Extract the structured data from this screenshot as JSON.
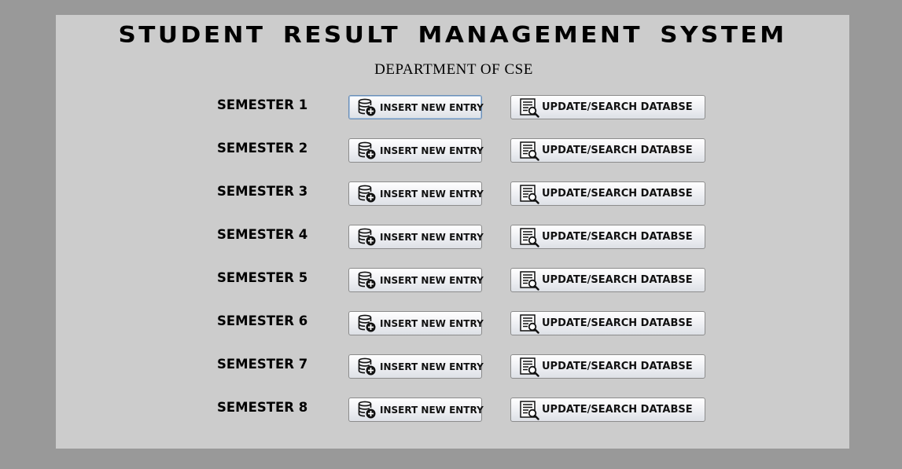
{
  "app": {
    "title": "STUDENT RESULT MANAGEMENT SYSTEM",
    "subtitle": "DEPARTMENT OF CSE"
  },
  "icons": {
    "insert": "database-add-icon",
    "update": "database-search-icon"
  },
  "semesters": [
    {
      "label": "SEMESTER 1",
      "insert_label": "INSERT NEW ENTRY",
      "update_label": "UPDATE/SEARCH DATABSE"
    },
    {
      "label": "SEMESTER 2",
      "insert_label": "INSERT NEW ENTRY",
      "update_label": "UPDATE/SEARCH DATABSE"
    },
    {
      "label": "SEMESTER 3",
      "insert_label": "INSERT NEW ENTRY",
      "update_label": "UPDATE/SEARCH DATABSE"
    },
    {
      "label": "SEMESTER 4",
      "insert_label": "INSERT NEW ENTRY",
      "update_label": "UPDATE/SEARCH DATABSE"
    },
    {
      "label": "SEMESTER 5",
      "insert_label": "INSERT NEW ENTRY",
      "update_label": "UPDATE/SEARCH DATABSE"
    },
    {
      "label": "SEMESTER 6",
      "insert_label": "INSERT NEW ENTRY",
      "update_label": "UPDATE/SEARCH DATABSE"
    },
    {
      "label": "SEMESTER 7",
      "insert_label": "INSERT NEW ENTRY",
      "update_label": "UPDATE/SEARCH DATABSE"
    },
    {
      "label": "SEMESTER 8",
      "insert_label": "INSERT NEW ENTRY",
      "update_label": "UPDATE/SEARCH DATABSE"
    }
  ]
}
